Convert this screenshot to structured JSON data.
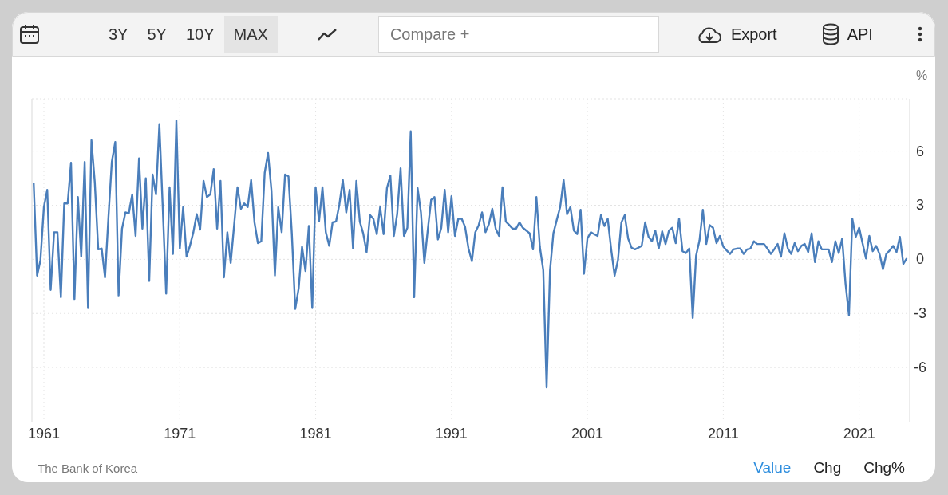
{
  "toolbar": {
    "ranges": [
      {
        "label": "3Y",
        "selected": false
      },
      {
        "label": "5Y",
        "selected": false
      },
      {
        "label": "10Y",
        "selected": false
      },
      {
        "label": "MAX",
        "selected": true
      }
    ],
    "compare": {
      "placeholder": "Compare +"
    },
    "actions": [
      {
        "kind": "export",
        "label": "Export"
      },
      {
        "kind": "api",
        "label": "API"
      }
    ]
  },
  "chart": {
    "unit": "%",
    "chart_data": {
      "type": "line",
      "xlim": [
        1960.12,
        2024.72
      ],
      "ylim": [
        -9,
        8.9
      ],
      "xticks": [
        {
          "value": 1961,
          "label": "1961"
        },
        {
          "value": 1971,
          "label": "1971"
        },
        {
          "value": 1981,
          "label": "1981"
        },
        {
          "value": 1991,
          "label": "1991"
        },
        {
          "value": 2001,
          "label": "2001"
        },
        {
          "value": 2011,
          "label": "2011"
        },
        {
          "value": 2021,
          "label": "2021"
        }
      ],
      "yticks": [
        -6,
        -3,
        0,
        3,
        6
      ],
      "x": [
        1960.25,
        1960.5,
        1960.75,
        1961,
        1961.25,
        1961.5,
        1961.75,
        1962,
        1962.25,
        1962.5,
        1962.75,
        1963,
        1963.25,
        1963.5,
        1963.75,
        1964,
        1964.25,
        1964.5,
        1964.75,
        1965,
        1965.25,
        1965.5,
        1965.75,
        1966,
        1966.25,
        1966.5,
        1966.75,
        1967,
        1967.25,
        1967.5,
        1967.75,
        1968,
        1968.25,
        1968.5,
        1968.75,
        1969,
        1969.25,
        1969.5,
        1969.75,
        1970,
        1970.25,
        1970.5,
        1970.75,
        1971,
        1971.25,
        1971.5,
        1971.75,
        1972,
        1972.25,
        1972.5,
        1972.75,
        1973,
        1973.25,
        1973.5,
        1973.75,
        1974,
        1974.25,
        1974.5,
        1974.75,
        1975,
        1975.25,
        1975.5,
        1975.75,
        1976,
        1976.25,
        1976.5,
        1976.75,
        1977,
        1977.25,
        1977.5,
        1977.75,
        1978,
        1978.25,
        1978.5,
        1978.75,
        1979,
        1979.25,
        1979.5,
        1979.75,
        1980,
        1980.25,
        1980.5,
        1980.75,
        1981,
        1981.25,
        1981.5,
        1981.75,
        1982,
        1982.25,
        1982.5,
        1982.75,
        1983,
        1983.25,
        1983.5,
        1983.75,
        1984,
        1984.25,
        1984.5,
        1984.75,
        1985,
        1985.25,
        1985.5,
        1985.75,
        1986,
        1986.25,
        1986.5,
        1986.75,
        1987,
        1987.25,
        1987.5,
        1987.75,
        1988,
        1988.25,
        1988.5,
        1988.75,
        1989,
        1989.25,
        1989.5,
        1989.75,
        1990,
        1990.25,
        1990.5,
        1990.75,
        1991,
        1991.25,
        1991.5,
        1991.75,
        1992,
        1992.25,
        1992.5,
        1992.75,
        1993,
        1993.25,
        1993.5,
        1993.75,
        1994,
        1994.25,
        1994.5,
        1994.75,
        1995,
        1995.25,
        1995.5,
        1995.75,
        1996,
        1996.25,
        1996.5,
        1996.75,
        1997,
        1997.25,
        1997.5,
        1997.75,
        1998,
        1998.25,
        1998.5,
        1998.75,
        1999,
        1999.25,
        1999.5,
        1999.75,
        2000,
        2000.25,
        2000.5,
        2000.75,
        2001,
        2001.25,
        2001.5,
        2001.75,
        2002,
        2002.25,
        2002.5,
        2002.75,
        2003,
        2003.25,
        2003.5,
        2003.75,
        2004,
        2004.25,
        2004.5,
        2004.75,
        2005,
        2005.25,
        2005.5,
        2005.75,
        2006,
        2006.25,
        2006.5,
        2006.75,
        2007,
        2007.25,
        2007.5,
        2007.75,
        2008,
        2008.25,
        2008.5,
        2008.75,
        2009,
        2009.25,
        2009.5,
        2009.75,
        2010,
        2010.25,
        2010.5,
        2010.75,
        2011,
        2011.25,
        2011.5,
        2011.75,
        2012,
        2012.25,
        2012.5,
        2012.75,
        2013,
        2013.25,
        2013.5,
        2013.75,
        2014,
        2014.25,
        2014.5,
        2014.75,
        2015,
        2015.25,
        2015.5,
        2015.75,
        2016,
        2016.25,
        2016.5,
        2016.75,
        2017,
        2017.25,
        2017.5,
        2017.75,
        2018,
        2018.25,
        2018.5,
        2018.75,
        2019,
        2019.25,
        2019.5,
        2019.75,
        2020,
        2020.25,
        2020.5,
        2020.75,
        2021,
        2021.25,
        2021.5,
        2021.75,
        2022,
        2022.25,
        2022.5,
        2022.75,
        2023,
        2023.25,
        2023.5,
        2023.75,
        2024,
        2024.25,
        2024.5
      ],
      "grid": true,
      "series": [
        {
          "color": "#4a7ebb",
          "values": [
            4.25,
            -0.9,
            -0.05,
            2.9,
            3.85,
            -1.7,
            1.5,
            1.5,
            -2.1,
            3.1,
            3.1,
            5.35,
            -2.2,
            3.45,
            0.15,
            5.4,
            -2.7,
            6.6,
            4.25,
            0.55,
            0.6,
            -1.0,
            2.35,
            5.4,
            6.5,
            -2.0,
            1.7,
            2.6,
            2.55,
            3.6,
            1.3,
            5.6,
            1.7,
            4.5,
            -1.2,
            4.7,
            3.6,
            7.5,
            2.8,
            -1.9,
            4.0,
            0.3,
            7.7,
            0.6,
            2.9,
            0.15,
            0.75,
            1.5,
            2.5,
            1.65,
            4.35,
            3.45,
            3.6,
            5.0,
            1.7,
            4.35,
            -1.0,
            1.5,
            -0.2,
            1.9,
            4.0,
            2.8,
            3.1,
            2.9,
            4.4,
            2.05,
            0.9,
            1.0,
            4.8,
            5.9,
            3.8,
            -0.9,
            2.9,
            1.5,
            4.7,
            4.6,
            1.45,
            -2.75,
            -1.6,
            0.7,
            -0.65,
            1.85,
            -2.7,
            4.0,
            2.1,
            4.0,
            1.5,
            0.75,
            2.05,
            2.1,
            3.05,
            4.4,
            2.6,
            3.85,
            0.6,
            4.35,
            2.1,
            1.45,
            0.4,
            2.45,
            2.25,
            1.4,
            2.9,
            1.4,
            3.95,
            4.65,
            1.3,
            2.5,
            5.05,
            1.3,
            1.75,
            7.1,
            -2.1,
            3.95,
            2.6,
            -0.2,
            1.6,
            3.3,
            3.45,
            1.1,
            1.75,
            3.85,
            1.5,
            3.5,
            1.3,
            2.25,
            2.25,
            1.8,
            0.6,
            -0.1,
            1.5,
            1.9,
            2.6,
            1.5,
            1.95,
            2.8,
            1.7,
            1.3,
            4.0,
            2.1,
            1.9,
            1.7,
            1.7,
            2.05,
            1.75,
            1.6,
            1.45,
            0.55,
            3.45,
            0.7,
            -0.6,
            -7.1,
            -0.6,
            1.45,
            2.2,
            2.9,
            4.4,
            2.5,
            2.9,
            1.6,
            1.4,
            2.75,
            -0.8,
            1.15,
            1.5,
            1.4,
            1.3,
            2.45,
            1.85,
            2.25,
            0.55,
            -0.9,
            -0.05,
            2.05,
            2.45,
            1.15,
            0.65,
            0.55,
            0.65,
            0.75,
            2.05,
            1.25,
            1.0,
            1.6,
            0.6,
            1.55,
            0.85,
            1.6,
            1.75,
            0.9,
            2.25,
            0.45,
            0.35,
            0.6,
            -3.25,
            0.2,
            1.05,
            2.75,
            0.85,
            1.9,
            1.75,
            0.9,
            1.3,
            0.7,
            0.5,
            0.3,
            0.55,
            0.6,
            0.6,
            0.3,
            0.55,
            0.6,
            1.0,
            0.85,
            0.85,
            0.85,
            0.6,
            0.3,
            0.55,
            0.85,
            0.15,
            1.45,
            0.6,
            0.3,
            0.9,
            0.45,
            0.75,
            0.85,
            0.4,
            1.45,
            -0.15,
            1.0,
            0.55,
            0.55,
            0.55,
            -0.15,
            1.0,
            0.35,
            1.15,
            -1.35,
            -3.1,
            2.25,
            1.25,
            1.75,
            0.9,
            0.05,
            1.3,
            0.45,
            0.75,
            0.3,
            -0.55,
            0.3,
            0.5,
            0.75,
            0.4,
            1.25,
            -0.25,
            0.05
          ]
        }
      ]
    }
  },
  "footer": {
    "source": "The Bank of Korea",
    "views": [
      {
        "label": "Value",
        "selected": true
      },
      {
        "label": "Chg",
        "selected": false
      },
      {
        "label": "Chg%",
        "selected": false
      }
    ]
  }
}
